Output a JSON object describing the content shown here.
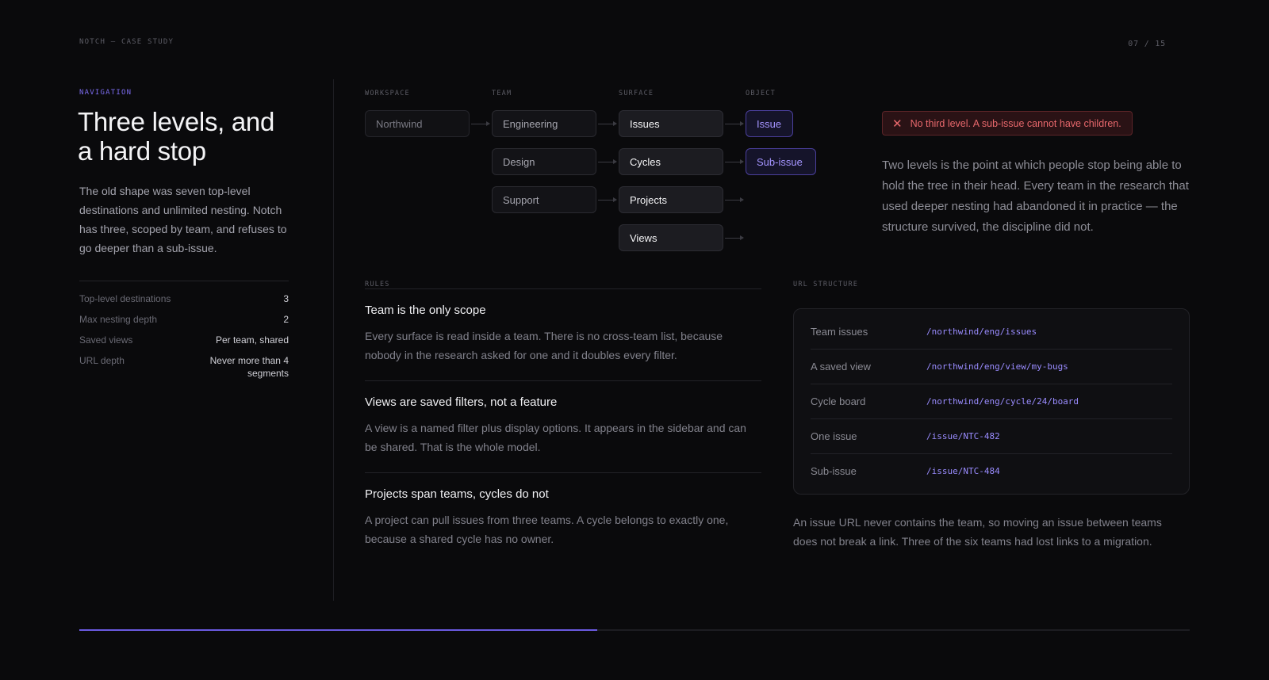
{
  "header": {
    "kicker": "NOTCH — CASE STUDY",
    "page_indicator": "07 / 15"
  },
  "left": {
    "section_label": "NAVIGATION",
    "headline_line1": "Three levels, and",
    "headline_line2": "a hard stop",
    "intro": "The old shape was seven top-level destinations and unlimited nesting. Notch has three, scoped by team, and refuses to go deeper than a sub-issue.",
    "stats": [
      {
        "label": "Top-level destinations",
        "value": "3"
      },
      {
        "label": "Max nesting depth",
        "value": "2"
      },
      {
        "label": "Saved views",
        "value": "Per team, shared"
      },
      {
        "label": "URL depth",
        "value": "Never more than 4 segments"
      }
    ]
  },
  "tree": {
    "columns": [
      "WORKSPACE",
      "TEAM",
      "SURFACE",
      "OBJECT"
    ],
    "workspace": "Northwind",
    "teams": [
      "Engineering",
      "Design",
      "Support"
    ],
    "surfaces": [
      "Issues",
      "Cycles",
      "Projects",
      "Views"
    ],
    "objects": [
      "Issue",
      "Sub-issue"
    ],
    "warning": "No third level. A sub-issue cannot have children.",
    "warning_icon": "close-x-icon",
    "note": "Two levels is the point at which people stop being able to hold the tree in their head. Every team in the research that used deeper nesting had abandoned it in practice — the structure survived, the discipline did not."
  },
  "rules": {
    "label": "RULES",
    "items": [
      {
        "title": "Team is the only scope",
        "body": "Every surface is read inside a team. There is no cross-team list, because nobody in the research asked for one and it doubles every filter."
      },
      {
        "title": "Views are saved filters, not a feature",
        "body": "A view is a named filter plus display options. It appears in the sidebar and can be shared. That is the whole model."
      },
      {
        "title": "Projects span teams, cycles do not",
        "body": "A project can pull issues from three teams. A cycle belongs to exactly one, because a shared cycle has no owner."
      }
    ]
  },
  "urls": {
    "label": "URL STRUCTURE",
    "rows": [
      {
        "label": "Team issues",
        "path": "/northwind/eng/issues"
      },
      {
        "label": "A saved view",
        "path": "/northwind/eng/view/my-bugs"
      },
      {
        "label": "Cycle board",
        "path": "/northwind/eng/cycle/24/board"
      },
      {
        "label": "One issue",
        "path": "/issue/NTC-482"
      },
      {
        "label": "Sub-issue",
        "path": "/issue/NTC-484"
      }
    ],
    "note": "An issue URL never contains the team, so moving an issue between teams does not break a link. Three of the six teams had lost links to a migration."
  },
  "progress": {
    "fraction": 0.4667
  },
  "colors": {
    "accent": "#7c6cf0",
    "error": "#e8686c",
    "background": "#0a0a0c"
  }
}
